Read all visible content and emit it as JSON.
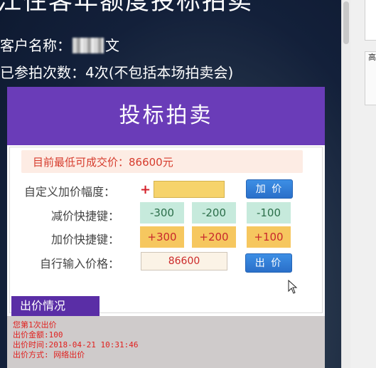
{
  "background": {
    "hero_title": "江住客年额度投标拍卖",
    "customer_label": "客户名称：",
    "customer_name_visible": "文",
    "attempts_text": "已参拍次数：4次(不包括本场拍卖会)"
  },
  "modal": {
    "title": "投标拍卖",
    "min_price_text": "目前最低可成交价：86600元",
    "custom_raise_label": "自定义加价幅度：",
    "plus_sign": "+",
    "custom_raise_value": "",
    "raise_button": "加 价",
    "decrease_label": "减价快捷键：",
    "decrease_buttons": [
      "-300",
      "-200",
      "-100"
    ],
    "increase_label": "加价快捷键：",
    "increase_buttons": [
      "+300",
      "+200",
      "+100"
    ],
    "manual_price_label": "自行输入价格：",
    "manual_price_value": "86600",
    "bid_button": "出 价"
  },
  "bid_history": {
    "tab_label": "出价情况",
    "lines": [
      "您第1次出价",
      "出价金额:100",
      "出价时间:2018-04-21 10:31:46",
      "出价方式: 网络出价"
    ]
  },
  "right_panel": {
    "glyph": "高"
  },
  "colors": {
    "header_purple": "#6a3cb8",
    "price_red": "#d63c2d",
    "decrease_green": "#c6eadc",
    "increase_orange": "#f6c75f",
    "button_blue": "#2a6fc9"
  }
}
